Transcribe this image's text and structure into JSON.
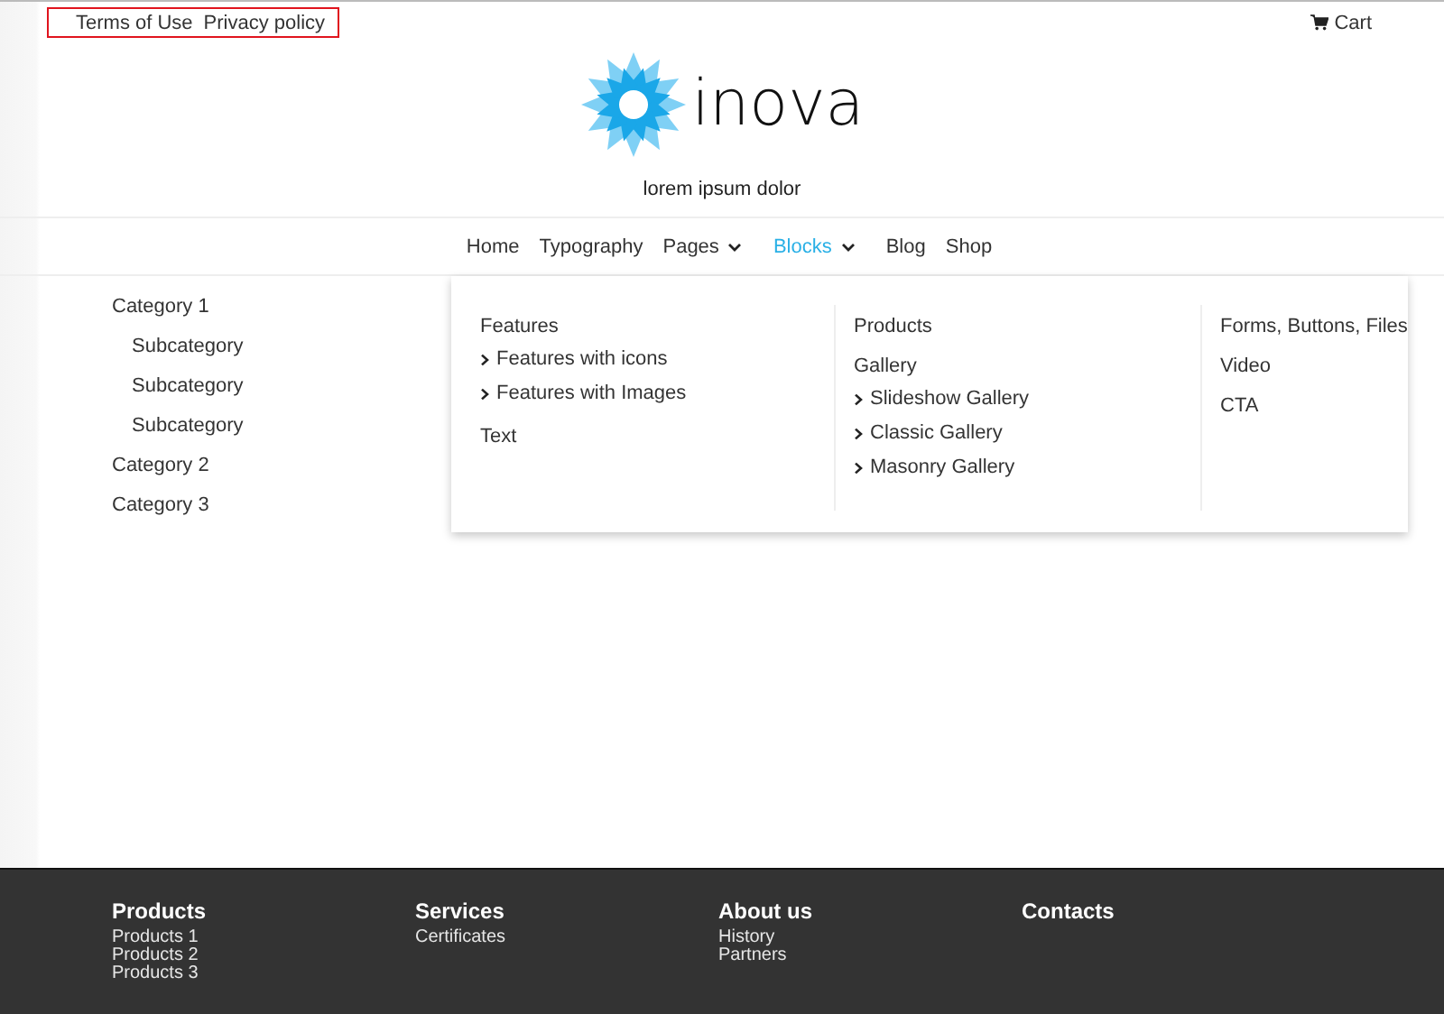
{
  "top_links": [
    "Terms of Use",
    "Privacy policy"
  ],
  "cart": {
    "label": "Cart"
  },
  "logo": {
    "name": "inova"
  },
  "tagline": "lorem ipsum dolor",
  "nav": [
    {
      "label": "Home",
      "selected": false,
      "dropdown": false
    },
    {
      "label": "Typography",
      "selected": false,
      "dropdown": false
    },
    {
      "label": "Pages",
      "selected": false,
      "dropdown": true
    },
    {
      "label": "Blocks",
      "selected": true,
      "dropdown": true
    },
    {
      "label": "Blog",
      "selected": false,
      "dropdown": false
    },
    {
      "label": "Shop",
      "selected": false,
      "dropdown": false
    }
  ],
  "sidebar": {
    "items": [
      {
        "label": "Category 1",
        "children": [
          {
            "label": "Subcategory"
          },
          {
            "label": "Subcategory"
          },
          {
            "label": "Subcategory"
          }
        ]
      },
      {
        "label": "Category 2"
      },
      {
        "label": "Category 3"
      }
    ]
  },
  "mega_menu": {
    "columns": [
      [
        {
          "kind": "heading",
          "label": "Features"
        },
        {
          "kind": "link",
          "label": "Features with icons"
        },
        {
          "kind": "link",
          "label": "Features with Images"
        },
        {
          "kind": "heading",
          "label": "Text"
        }
      ],
      [
        {
          "kind": "heading",
          "label": "Products"
        },
        {
          "kind": "heading",
          "label": "Gallery"
        },
        {
          "kind": "link",
          "label": "Slideshow Gallery"
        },
        {
          "kind": "link",
          "label": "Classic Gallery"
        },
        {
          "kind": "link",
          "label": "Masonry Gallery"
        }
      ],
      [
        {
          "kind": "heading",
          "label": "Forms, Buttons, Files"
        },
        {
          "kind": "heading",
          "label": "Video"
        },
        {
          "kind": "heading",
          "label": "CTA"
        }
      ]
    ]
  },
  "footer": {
    "columns": [
      {
        "title": "Products",
        "links": [
          "Products 1",
          "Products 2",
          "Products 3"
        ]
      },
      {
        "title": "Services",
        "links": [
          "Certificates"
        ]
      },
      {
        "title": "About us",
        "links": [
          "History",
          "Partners"
        ]
      },
      {
        "title": "Contacts"
      }
    ]
  }
}
